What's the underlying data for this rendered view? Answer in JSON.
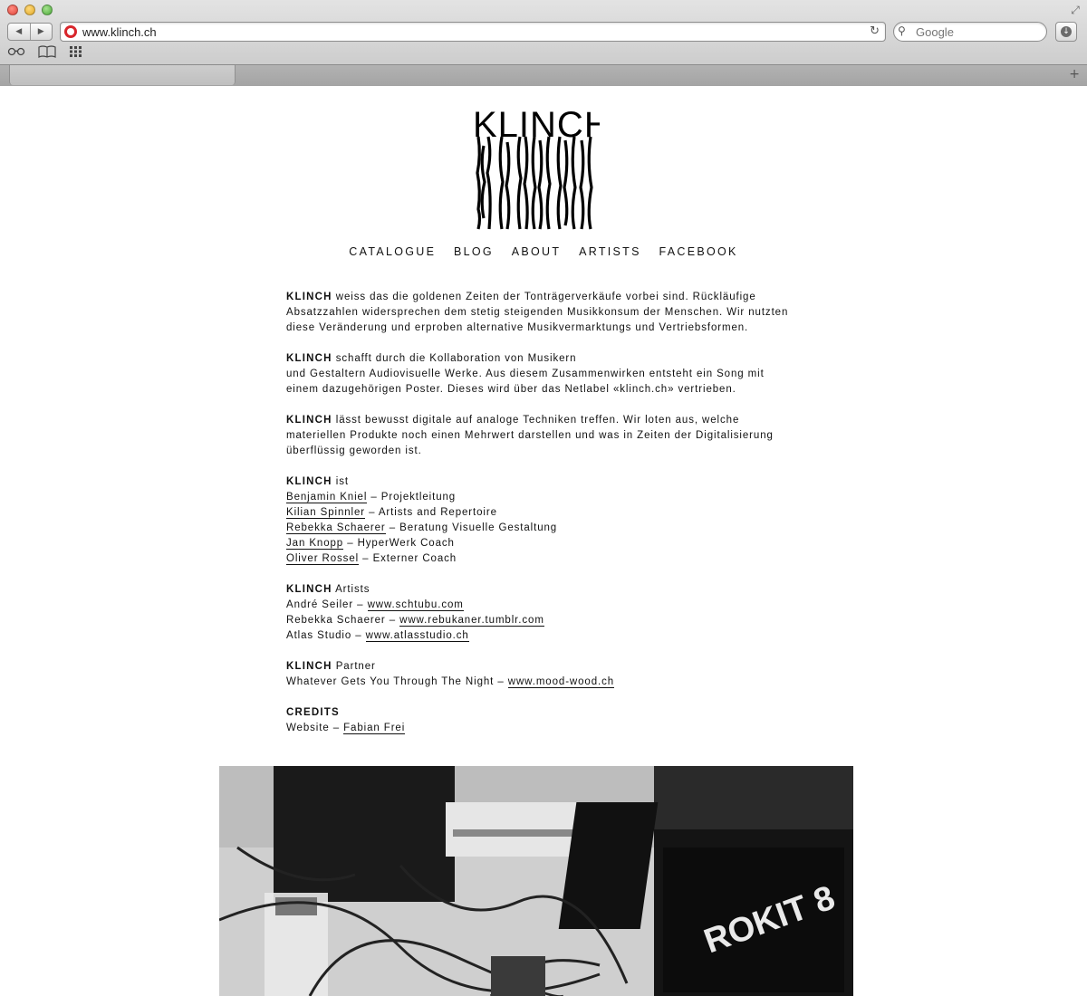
{
  "browser": {
    "url": "www.klinch.ch",
    "search_placeholder": "Google",
    "back_glyph": "◀",
    "forward_glyph": "▶",
    "reload_glyph": "↻",
    "search_glyph": "⚲",
    "download_glyph": "↓",
    "fullscreen_glyph": "⤢",
    "newtab_glyph": "+",
    "bookmarks_icons": [
      "reading-list-icon",
      "bookmarks-book-icon",
      "top-sites-grid-icon"
    ]
  },
  "site": {
    "logo_text": "KLINCH",
    "nav": [
      "CATALOGUE",
      "BLOG",
      "ABOUT",
      "ARTISTS",
      "FACEBOOK"
    ],
    "para1": {
      "brand": "KLINCH",
      "text": " weiss das die goldenen Zeiten der Tonträgerverkäufe vorbei sind. Rückläufige Absatzzahlen widersprechen dem stetig steigenden Musikkonsum der Menschen. Wir nutzten diese Veränderung und erproben alternative Musikvermarktungs und Vertriebsformen."
    },
    "para2": {
      "brand": "KLINCH",
      "line1": " schafft durch die Kollaboration von Musikern",
      "line2": "und Gestaltern Audiovisuelle Werke. Aus diesem Zusammenwirken entsteht ein Song mit einem dazugehörigen Poster. Dieses wird über das Netlabel «klinch.ch» vertrieben."
    },
    "para3": {
      "brand": "KLINCH",
      "text": " lässt bewusst digitale auf analoge Techniken treffen. Wir loten aus, welche materiellen Produkte noch einen Mehrwert darstellen und was in Zeiten der Digitalisierung überflüssig geworden ist."
    },
    "team": {
      "brand": "KLINCH",
      "suffix": " ist",
      "members": [
        {
          "name": "Benjamin Kniel",
          "role": " – Projektleitung"
        },
        {
          "name": "Kilian Spinnler",
          "role": " – Artists and Repertoire"
        },
        {
          "name": "Rebekka Schaerer",
          "role": " – Beratung Visuelle Gestaltung"
        },
        {
          "name": "Jan Knopp",
          "role": " – HyperWerk Coach"
        },
        {
          "name": "Oliver Rossel",
          "role": " – Externer Coach"
        }
      ]
    },
    "artists": {
      "brand": "KLINCH",
      "suffix": " Artists",
      "items": [
        {
          "name": "André Seiler – ",
          "link": "www.schtubu.com"
        },
        {
          "name": "Rebekka Schaerer – ",
          "link": "www.rebukaner.tumblr.com"
        },
        {
          "name": "Atlas Studio – ",
          "link": "www.atlasstudio.ch"
        }
      ]
    },
    "partner": {
      "brand": "KLINCH",
      "suffix": " Partner",
      "name": "Whatever Gets You Through The Night – ",
      "link": "www.mood-wood.ch"
    },
    "credits": {
      "heading": "CREDITS",
      "label": "Website – ",
      "link": "Fabian Frei"
    }
  }
}
